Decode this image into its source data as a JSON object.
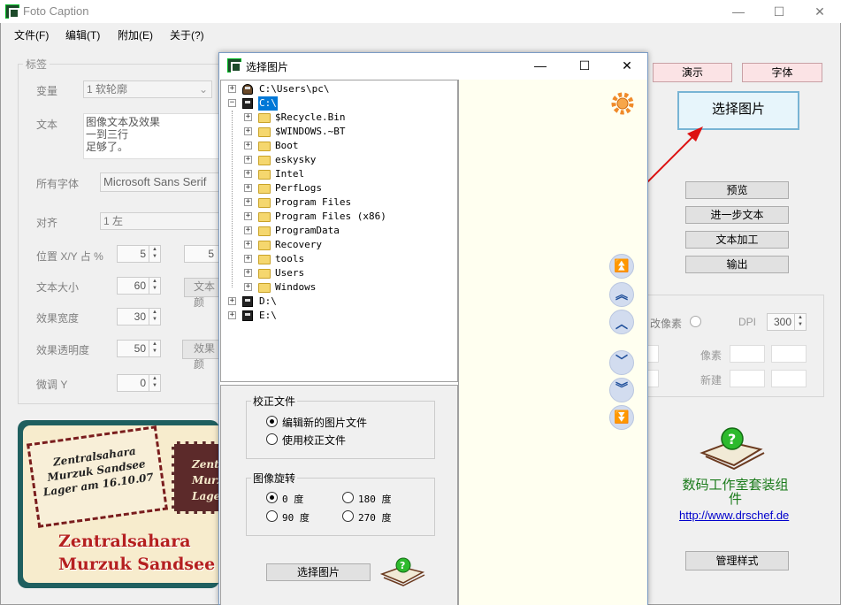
{
  "window": {
    "title": "Foto Caption",
    "minimize": "—",
    "maximize": "☐",
    "close": "✕"
  },
  "menu": [
    "文件(F)",
    "编辑(T)",
    "附加(E)",
    "关于(?)"
  ],
  "labels_group": {
    "title": "标签",
    "variant_label": "变量",
    "variant_value": "1 软轮廓",
    "text_label": "文本",
    "text_lines": [
      "图像文本及效果",
      "一到三行",
      "足够了。"
    ],
    "fonts_label": "所有字体",
    "font_value": "Microsoft Sans Serif",
    "align_label": "对齐",
    "align_value": "1 左",
    "pos_label": "位置 X/Y 占 %",
    "pos_x": "5",
    "pos_y": "5",
    "size_label": "文本大小",
    "size_value": "60",
    "size_btn": "文本颜",
    "width_label": "效果宽度",
    "width_value": "30",
    "opacity_label": "效果透明度",
    "opacity_value": "50",
    "opacity_btn": "效果颜",
    "fine_label": "微调 Y",
    "fine_value": "0"
  },
  "right_panel": {
    "demo": "演示",
    "font": "字体",
    "select_image": "选择图片",
    "preview": "预览",
    "more_text": "进一步文本",
    "text_process": "文本加工",
    "output": "输出",
    "resize_label": "改像素",
    "dpi_label": "DPI",
    "dpi_value": "300",
    "pixel_label": "像素",
    "new_label": "新建",
    "brand": "数码工作室套装组件",
    "url": "http://www.drschef.de",
    "manage_style": "管理样式"
  },
  "thumbnail": {
    "stamp_lines": [
      "Zentralsahara",
      "Murzuk Sandsee",
      "Lager am 16.10.07"
    ],
    "stamp2_lines": [
      "Zent",
      "Murz",
      "Lager"
    ],
    "bottom_lines": [
      "Zentralsahara",
      "Murzuk Sandsee"
    ]
  },
  "dialog": {
    "title": "选择图片",
    "minimize": "—",
    "maximize": "☐",
    "close": "✕",
    "tree": [
      {
        "label": "C:\\Users\\pc\\",
        "indent": 0,
        "kind": "user",
        "expander": "+"
      },
      {
        "label": "C:\\",
        "indent": 0,
        "kind": "drive",
        "expander": "−",
        "selected": true
      },
      {
        "label": "$Recycle.Bin",
        "indent": 1,
        "kind": "folder",
        "expander": "+"
      },
      {
        "label": "$WINDOWS.~BT",
        "indent": 1,
        "kind": "folder",
        "expander": "+"
      },
      {
        "label": "Boot",
        "indent": 1,
        "kind": "folder",
        "expander": "+"
      },
      {
        "label": "eskysky",
        "indent": 1,
        "kind": "folder",
        "expander": "+"
      },
      {
        "label": "Intel",
        "indent": 1,
        "kind": "folder",
        "expander": "+"
      },
      {
        "label": "PerfLogs",
        "indent": 1,
        "kind": "folder",
        "expander": "+"
      },
      {
        "label": "Program Files",
        "indent": 1,
        "kind": "folder",
        "expander": "+"
      },
      {
        "label": "Program Files (x86)",
        "indent": 1,
        "kind": "folder",
        "expander": "+"
      },
      {
        "label": "ProgramData",
        "indent": 1,
        "kind": "folder",
        "expander": "+"
      },
      {
        "label": "Recovery",
        "indent": 1,
        "kind": "folder",
        "expander": "+"
      },
      {
        "label": "tools",
        "indent": 1,
        "kind": "folder",
        "expander": "+"
      },
      {
        "label": "Users",
        "indent": 1,
        "kind": "folder",
        "expander": "+"
      },
      {
        "label": "Windows",
        "indent": 1,
        "kind": "folder",
        "expander": "+"
      },
      {
        "label": "D:\\",
        "indent": 0,
        "kind": "drive",
        "expander": "+"
      },
      {
        "label": "E:\\",
        "indent": 0,
        "kind": "drive",
        "expander": "+"
      }
    ],
    "correction": {
      "title": "校正文件",
      "opt1": "编辑新的图片文件",
      "opt2": "使用校正文件"
    },
    "rotation": {
      "title": "图像旋转",
      "r0": "0 度",
      "r180": "180 度",
      "r90": "90 度",
      "r270": "270 度"
    },
    "select_btn": "选择图片",
    "nav": [
      "⏫",
      "︽",
      "︿",
      "﹀",
      "︾",
      "⏬"
    ]
  }
}
